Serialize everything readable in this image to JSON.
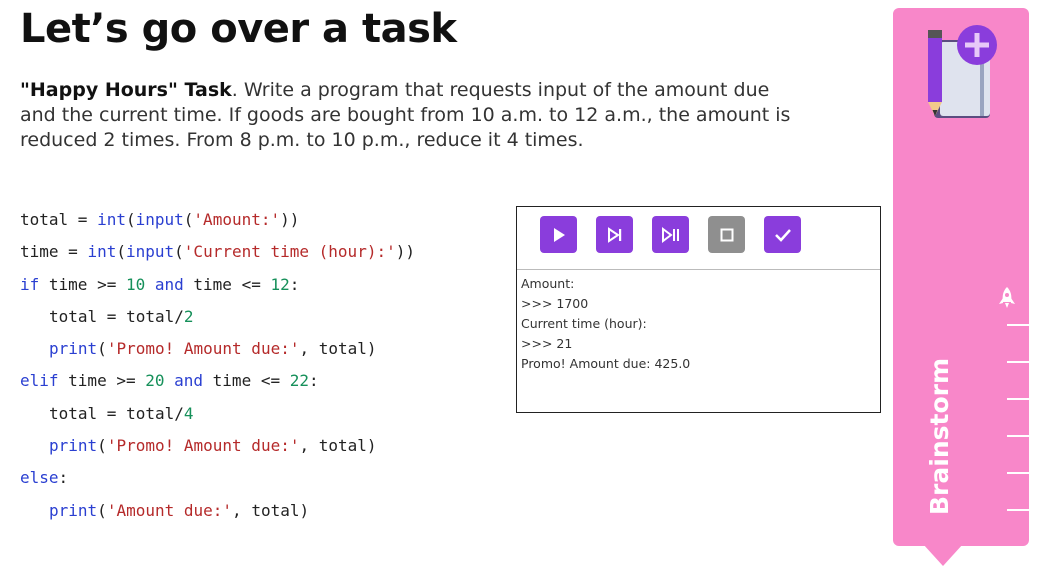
{
  "title": "Let’s go over a task",
  "task": {
    "bold_lead": "\"Happy Hours\" Task",
    "text": ". Write a program that requests input of the amount due and the current time. If goods are bought from 10 a.m. to 12 a.m., the amount is reduced 2 times. From 8 p.m. to 10 p.m., reduce it 4 times."
  },
  "code": {
    "l1": {
      "a": "total = ",
      "b": "int",
      "c": "(",
      "d": "input",
      "e": "(",
      "f": "'Amount:'",
      "g": "))"
    },
    "l2": {
      "a": "time = ",
      "b": "int",
      "c": "(",
      "d": "input",
      "e": "(",
      "f": "'Current time (hour):'",
      "g": "))"
    },
    "l3": {
      "a": "if",
      "b": " time >= ",
      "c": "10",
      "d": " and",
      "e": " time <= ",
      "f": "12",
      "g": ":"
    },
    "l4": {
      "a": "total = total/",
      "b": "2"
    },
    "l5": {
      "a": "print",
      "b": "(",
      "c": "'Promo! Amount due:'",
      "d": ", total)"
    },
    "l6": {
      "a": "elif",
      "b": " time >= ",
      "c": "20",
      "d": " and",
      "e": " time <= ",
      "f": "22",
      "g": ":"
    },
    "l7": {
      "a": "total = total/",
      "b": "4"
    },
    "l8": {
      "a": "print",
      "b": "(",
      "c": "'Promo! Amount due:'",
      "d": ", total)"
    },
    "l9": {
      "a": "else",
      "b": ":"
    },
    "l10": {
      "a": "print",
      "b": "(",
      "c": "'Amount due:'",
      "d": ", total)"
    }
  },
  "console": {
    "toolbar": [
      "run",
      "step-over",
      "step-into",
      "stop",
      "check"
    ],
    "output": [
      "Amount:",
      ">>> 1700",
      "Current time (hour):",
      ">>> 21",
      "Promo! Amount due: 425.0"
    ]
  },
  "sidebar": {
    "label": "Brainstorm",
    "icons": [
      "notebook-pencil-plus-icon",
      "rocket-icon"
    ],
    "color": "#f887c9",
    "accent": "#8a3ddc"
  }
}
